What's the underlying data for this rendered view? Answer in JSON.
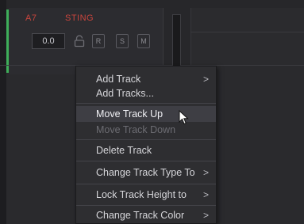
{
  "track": {
    "id": "A7",
    "name": "STING",
    "volume": "0.0",
    "buttons": {
      "record": "R",
      "solo": "S",
      "mute": "M"
    },
    "accent_color": "#3fae5a",
    "label_color": "#c9453d"
  },
  "context_menu": {
    "items": [
      {
        "label": "Add Track",
        "has_submenu": true,
        "arrow": ">"
      },
      {
        "label": "Add Tracks...",
        "has_submenu": false
      },
      {
        "label": "Move Track Up",
        "has_submenu": false,
        "highlighted": true
      },
      {
        "label": "Move Track Down",
        "has_submenu": false,
        "disabled": true
      },
      {
        "label": "Delete Track",
        "has_submenu": false
      },
      {
        "label": "Change Track Type To",
        "has_submenu": true,
        "arrow": ">"
      },
      {
        "label": "Lock Track Height to",
        "has_submenu": true,
        "arrow": ">"
      },
      {
        "label": "Change Track Color",
        "has_submenu": true,
        "arrow": ">"
      }
    ]
  },
  "icons": {
    "lock": "lock-icon",
    "cursor": "mouse-pointer-icon",
    "submenu": "chevron-right-icon"
  }
}
